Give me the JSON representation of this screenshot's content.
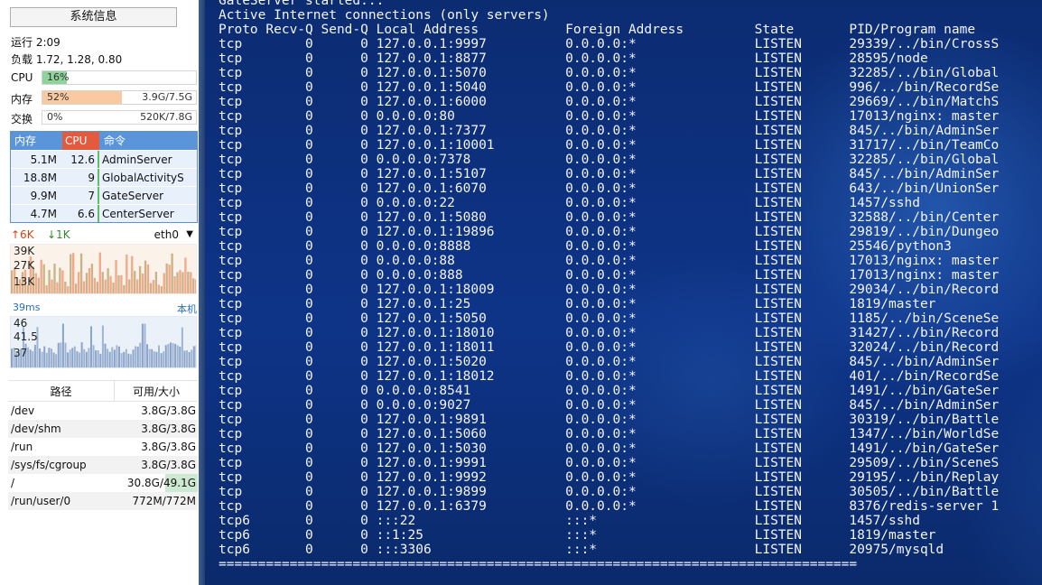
{
  "sidebar": {
    "sysinfo_button": "系统信息",
    "uptime": "运行 2:09",
    "load": "负载 1.72, 1.28, 0.80",
    "cpu": {
      "label": "CPU",
      "text": "16%",
      "percent": 16,
      "color": "#8fd39a"
    },
    "mem": {
      "label": "内存",
      "text": "52%",
      "percent": 52,
      "extra": "3.9G/7.5G",
      "color": "#f9c9a2"
    },
    "swap": {
      "label": "交换",
      "text": "0%",
      "percent": 0,
      "extra": "520K/7.8G",
      "color": "#cfe3f5"
    },
    "process_table": {
      "headers": {
        "mem": "内存",
        "cpu": "CPU",
        "cmd": "命令"
      },
      "rows": [
        {
          "mem": "5.1M",
          "cpu": "12.6",
          "cmd": "AdminServer"
        },
        {
          "mem": "18.8M",
          "cpu": "9",
          "cmd": "GlobalActivityS"
        },
        {
          "mem": "9.9M",
          "cpu": "7",
          "cmd": "GateServer"
        },
        {
          "mem": "4.7M",
          "cpu": "6.6",
          "cmd": "CenterServer"
        }
      ]
    },
    "network": {
      "upload": "↑6K",
      "download": "↓1K",
      "interface": "eth0",
      "labels": [
        "39K",
        "27K",
        "13K"
      ]
    },
    "ping": {
      "latency": "39ms",
      "host": "本机",
      "labels": [
        "46",
        "41.5",
        "37"
      ]
    },
    "disks": {
      "headers": {
        "path": "路径",
        "size": "可用/大小"
      },
      "rows": [
        {
          "path": "/dev",
          "size": "3.8G/3.8G"
        },
        {
          "path": "/dev/shm",
          "size": "3.8G/3.8G"
        },
        {
          "path": "/run",
          "size": "3.8G/3.8G"
        },
        {
          "path": "/sys/fs/cgroup",
          "size": "3.8G/3.8G"
        },
        {
          "path": "/",
          "size": "30.8G/49.1G"
        },
        {
          "path": "/run/user/0",
          "size": "772M/772M"
        }
      ]
    }
  },
  "terminal": {
    "lines": [
      "GateServer started...",
      "Active Internet connections (only servers)",
      "Proto Recv-Q Send-Q Local Address           Foreign Address         State       PID/Program name",
      "tcp        0      0 127.0.0.1:9997          0.0.0.0:*               LISTEN      29339/../bin/CrossS",
      "tcp        0      0 127.0.0.1:8877          0.0.0.0:*               LISTEN      28595/node",
      "tcp        0      0 127.0.0.1:5070          0.0.0.0:*               LISTEN      32285/../bin/Global",
      "tcp        0      0 127.0.0.1:5040          0.0.0.0:*               LISTEN      996/../bin/RecordSe",
      "tcp        0      0 127.0.0.1:6000          0.0.0.0:*               LISTEN      29669/../bin/MatchS",
      "tcp        0      0 0.0.0.0:80              0.0.0.0:*               LISTEN      17013/nginx: master",
      "tcp        0      0 127.0.0.1:7377          0.0.0.0:*               LISTEN      845/../bin/AdminSer",
      "tcp        0      0 127.0.0.1:10001         0.0.0.0:*               LISTEN      31717/../bin/TeamCo",
      "tcp        0      0 0.0.0.0:7378            0.0.0.0:*               LISTEN      32285/../bin/Global",
      "tcp        0      0 127.0.0.1:5107          0.0.0.0:*               LISTEN      845/../bin/AdminSer",
      "tcp        0      0 127.0.0.1:6070          0.0.0.0:*               LISTEN      643/../bin/UnionSer",
      "tcp        0      0 0.0.0.0:22              0.0.0.0:*               LISTEN      1457/sshd",
      "tcp        0      0 127.0.0.1:5080          0.0.0.0:*               LISTEN      32588/../bin/Center",
      "tcp        0      0 127.0.0.1:19896         0.0.0.0:*               LISTEN      29819/../bin/Dungeo",
      "tcp        0      0 0.0.0.0:8888            0.0.0.0:*               LISTEN      25546/python3",
      "tcp        0      0 0.0.0.0:88              0.0.0.0:*               LISTEN      17013/nginx: master",
      "tcp        0      0 0.0.0.0:888             0.0.0.0:*               LISTEN      17013/nginx: master",
      "tcp        0      0 127.0.0.1:18009         0.0.0.0:*               LISTEN      29034/../bin/Record",
      "tcp        0      0 127.0.0.1:25            0.0.0.0:*               LISTEN      1819/master",
      "tcp        0      0 127.0.0.1:5050          0.0.0.0:*               LISTEN      1185/../bin/SceneSe",
      "tcp        0      0 127.0.0.1:18010         0.0.0.0:*               LISTEN      31427/../bin/Record",
      "tcp        0      0 127.0.0.1:18011         0.0.0.0:*               LISTEN      32024/../bin/Record",
      "tcp        0      0 127.0.0.1:5020          0.0.0.0:*               LISTEN      845/../bin/AdminSer",
      "tcp        0      0 127.0.0.1:18012         0.0.0.0:*               LISTEN      401/../bin/RecordSe",
      "tcp        0      0 0.0.0.0:8541            0.0.0.0:*               LISTEN      1491/../bin/GateSer",
      "tcp        0      0 0.0.0.0:9027            0.0.0.0:*               LISTEN      845/../bin/AdminSer",
      "tcp        0      0 127.0.0.1:9891          0.0.0.0:*               LISTEN      30319/../bin/Battle",
      "tcp        0      0 127.0.0.1:5060          0.0.0.0:*               LISTEN      1347/../bin/WorldSe",
      "tcp        0      0 127.0.0.1:5030          0.0.0.0:*               LISTEN      1491/../bin/GateSer",
      "tcp        0      0 127.0.0.1:9991          0.0.0.0:*               LISTEN      29509/../bin/SceneS",
      "tcp        0      0 127.0.0.1:9992          0.0.0.0:*               LISTEN      29195/../bin/Replay",
      "tcp        0      0 127.0.0.1:9899          0.0.0.0:*               LISTEN      30505/../bin/Battle",
      "tcp        0      0 127.0.0.1:6379          0.0.0.0:*               LISTEN      8376/redis-server 1",
      "tcp6       0      0 :::22                   :::*                    LISTEN      1457/sshd",
      "tcp6       0      0 ::1:25                  :::*                    LISTEN      1819/master",
      "tcp6       0      0 :::3306                 :::*                    LISTEN      20975/mysqld",
      "================================================================================="
    ]
  }
}
